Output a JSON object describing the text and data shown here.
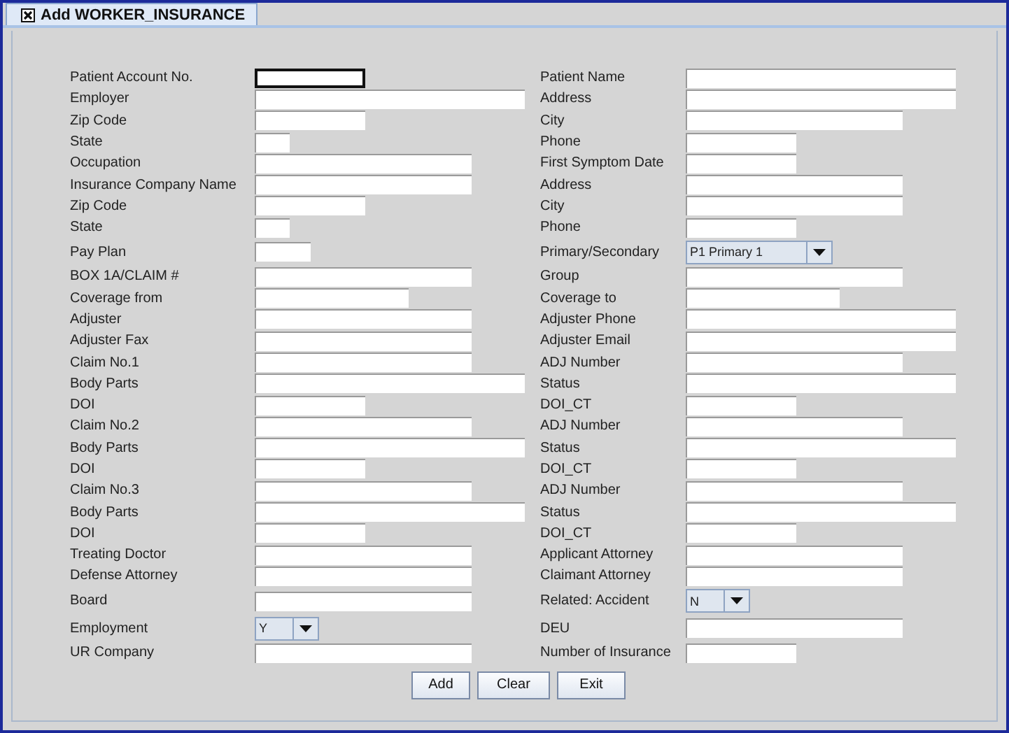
{
  "tab": {
    "title": "Add WORKER_INSURANCE"
  },
  "rows": [
    {
      "left": {
        "label": "Patient Account No.",
        "kind": "text",
        "focused": true
      },
      "right": {
        "label": "Patient Name",
        "kind": "text",
        "focused": false
      }
    },
    {
      "left": {
        "label": "Employer",
        "kind": "text",
        "focused": false
      },
      "right": {
        "label": "Address",
        "kind": "text",
        "focused": false
      }
    },
    {
      "left": {
        "label": "Zip Code",
        "kind": "text",
        "focused": false
      },
      "right": {
        "label": "City",
        "kind": "text",
        "focused": false
      }
    },
    {
      "left": {
        "label": "State",
        "kind": "text",
        "focused": false
      },
      "right": {
        "label": "Phone",
        "kind": "text",
        "focused": false
      }
    },
    {
      "left": {
        "label": "Occupation",
        "kind": "text",
        "focused": false
      },
      "right": {
        "label": "First Symptom Date",
        "kind": "text",
        "focused": false
      }
    },
    {
      "left": {
        "label": "Insurance Company Name",
        "kind": "text",
        "focused": false
      },
      "right": {
        "label": "Address",
        "kind": "text",
        "focused": false
      }
    },
    {
      "left": {
        "label": "Zip Code",
        "kind": "text",
        "focused": false
      },
      "right": {
        "label": "City",
        "kind": "text",
        "focused": false
      }
    },
    {
      "left": {
        "label": "State",
        "kind": "text",
        "focused": false
      },
      "right": {
        "label": "Phone",
        "kind": "text",
        "focused": false
      }
    },
    {
      "left": {
        "label": "Pay Plan",
        "kind": "text",
        "focused": false
      },
      "right": {
        "label": "Primary/Secondary",
        "kind": "combo",
        "value": "P1 Primary 1"
      }
    },
    {
      "left": {
        "label": "BOX 1A/CLAIM #",
        "kind": "text",
        "focused": false
      },
      "right": {
        "label": "Group",
        "kind": "text",
        "focused": false
      }
    },
    {
      "left": {
        "label": "Coverage from",
        "kind": "text",
        "focused": false
      },
      "right": {
        "label": "Coverage to",
        "kind": "text",
        "focused": false
      }
    },
    {
      "left": {
        "label": "Adjuster",
        "kind": "text",
        "focused": false
      },
      "right": {
        "label": "Adjuster Phone",
        "kind": "text",
        "focused": false
      }
    },
    {
      "left": {
        "label": "Adjuster Fax",
        "kind": "text",
        "focused": false
      },
      "right": {
        "label": "Adjuster Email",
        "kind": "text",
        "focused": false
      }
    },
    {
      "left": {
        "label": "Claim No.1",
        "kind": "text",
        "focused": false
      },
      "right": {
        "label": "ADJ Number",
        "kind": "text",
        "focused": false
      }
    },
    {
      "left": {
        "label": "Body Parts",
        "kind": "text",
        "focused": false
      },
      "right": {
        "label": "Status",
        "kind": "text",
        "focused": false
      }
    },
    {
      "left": {
        "label": "DOI",
        "kind": "text",
        "focused": false
      },
      "right": {
        "label": "DOI_CT",
        "kind": "text",
        "focused": false
      }
    },
    {
      "left": {
        "label": "Claim No.2",
        "kind": "text",
        "focused": false
      },
      "right": {
        "label": "ADJ Number",
        "kind": "text",
        "focused": false
      }
    },
    {
      "left": {
        "label": "Body Parts",
        "kind": "text",
        "focused": false
      },
      "right": {
        "label": "Status",
        "kind": "text",
        "focused": false
      }
    },
    {
      "left": {
        "label": "DOI",
        "kind": "text",
        "focused": false
      },
      "right": {
        "label": "DOI_CT",
        "kind": "text",
        "focused": false
      }
    },
    {
      "left": {
        "label": "Claim No.3",
        "kind": "text",
        "focused": false
      },
      "right": {
        "label": "ADJ Number",
        "kind": "text",
        "focused": false
      }
    },
    {
      "left": {
        "label": "Body Parts",
        "kind": "text",
        "focused": false
      },
      "right": {
        "label": "Status",
        "kind": "text",
        "focused": false
      }
    },
    {
      "left": {
        "label": "DOI",
        "kind": "text",
        "focused": false
      },
      "right": {
        "label": "DOI_CT",
        "kind": "text",
        "focused": false
      }
    },
    {
      "left": {
        "label": "Treating Doctor",
        "kind": "text",
        "focused": false
      },
      "right": {
        "label": "Applicant Attorney",
        "kind": "text",
        "focused": false
      }
    },
    {
      "left": {
        "label": "Defense Attorney",
        "kind": "text",
        "focused": false
      },
      "right": {
        "label": "Claimant Attorney",
        "kind": "text",
        "focused": false
      }
    },
    {
      "left": {
        "label": "Board",
        "kind": "text",
        "focused": false
      },
      "right": {
        "label": "Related: Accident",
        "kind": "combo",
        "value": "N"
      }
    },
    {
      "left": {
        "label": "Employment",
        "kind": "combo",
        "value": "Y"
      },
      "right": {
        "label": "DEU",
        "kind": "text",
        "focused": false
      }
    },
    {
      "left": {
        "label": "UR Company",
        "kind": "text",
        "focused": false
      },
      "right": {
        "label": "Number of Insurance",
        "kind": "text",
        "focused": false
      }
    }
  ],
  "buttons": [
    "Add",
    "Clear",
    "Exit"
  ]
}
